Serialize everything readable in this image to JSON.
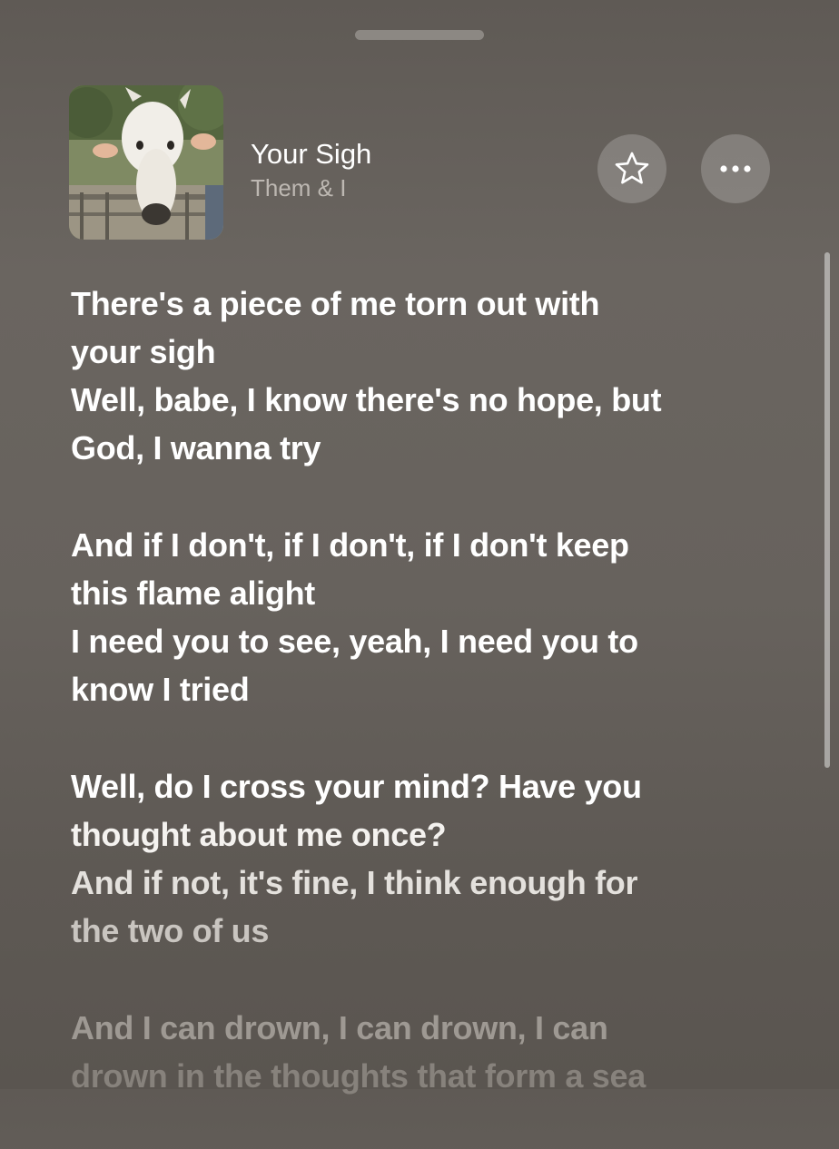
{
  "now_playing": {
    "title": "Your Sigh",
    "artist": "Them & I",
    "artwork_icon": "album-artwork-white-horse"
  },
  "actions": {
    "favorite_icon": "star-outline-icon",
    "more_icon": "ellipsis-icon"
  },
  "lyrics": [
    [
      "There's a piece of me torn out with",
      "your sigh",
      "Well, babe, I know there's no hope, but",
      "God, I wanna try"
    ],
    [
      "And if I don't, if I don't, if I don't keep",
      "this flame alight",
      "I need you to see, yeah, I need you to",
      "know I tried"
    ],
    [
      "Well, do I cross your mind? Have you",
      "thought about me once?",
      "And if not, it's fine, I think enough for",
      "the two of us"
    ],
    [
      "And I can drown, I can drown, I can",
      "drown in the thoughts that form a sea"
    ]
  ],
  "colors": {
    "background": "#66615c",
    "text": "#ffffff",
    "secondary_text": "#bdb8b2"
  }
}
